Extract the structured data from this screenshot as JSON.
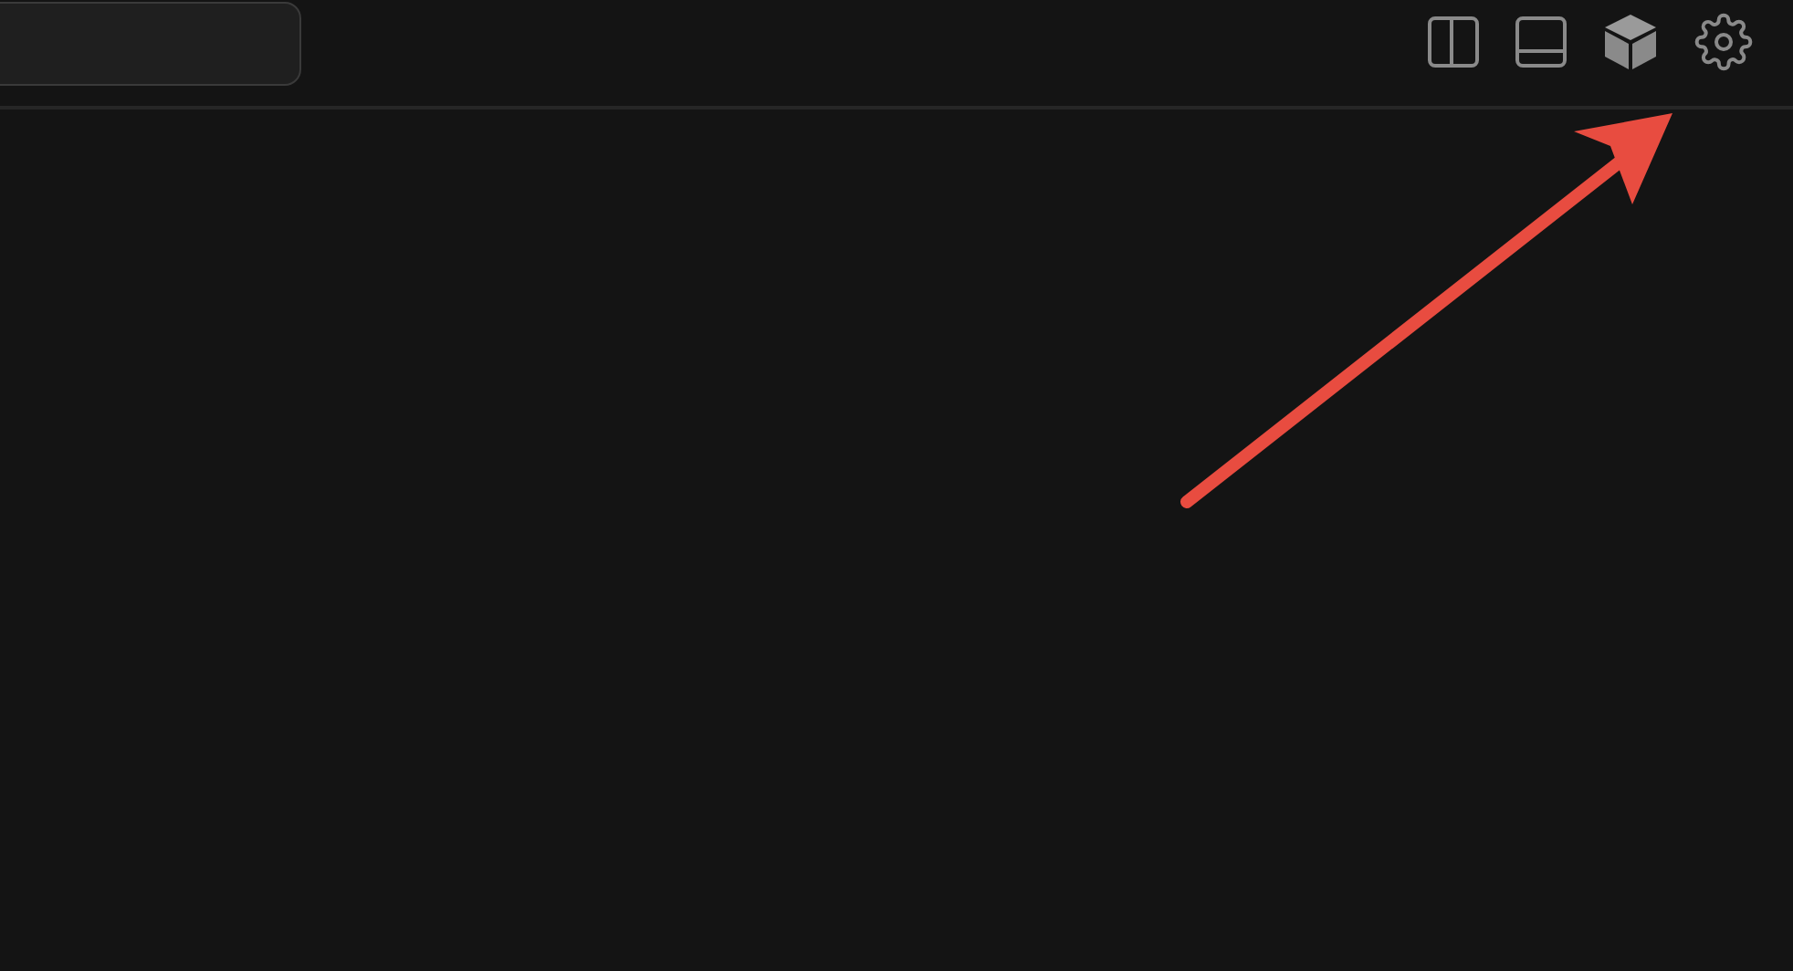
{
  "toolbar": {
    "icons": [
      {
        "kind": "sidebar"
      },
      {
        "kind": "panel"
      },
      {
        "kind": "cube"
      },
      {
        "kind": "settings"
      }
    ]
  },
  "annotation": {
    "kind": "arrow"
  }
}
